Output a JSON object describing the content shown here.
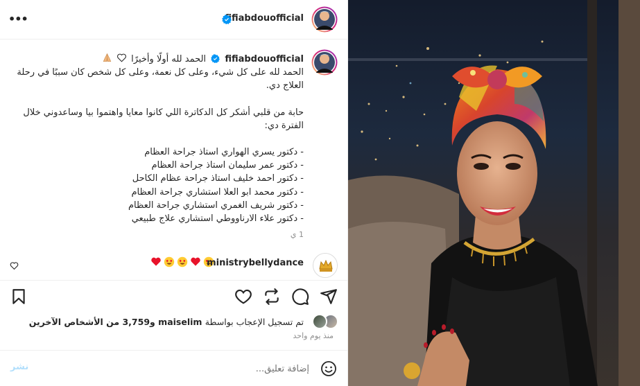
{
  "post": {
    "author": "fifiabdouofficial",
    "caption": {
      "headline": "الحمد لله أولًا وأخيرًا",
      "paragraph1": "الحمد لله على كل شيء، وعلى كل نعمة، وعلى كل شخص كان سببًا في رحلة العلاج دي.",
      "paragraph2": "حابة من قلبي أشكر كل الدكاترة اللي كانوا معايا واهتموا بيا وساعدوني خلال الفترة دي:",
      "doctors": [
        "- دكتور يسري الهواري استاذ جراحة العظام",
        "- دكتور عمر سليمان استاذ جراحة العظام",
        "- دكتور احمد خليف استاذ جراحة عظام الكاحل",
        "- دكتور محمد ابو العلا استشاري جراحة العظام",
        "- دكتور شريف الغمري استشاري جراحة العظام",
        "- دكتور علاء الارناووطي استشاري علاج طبيعي"
      ],
      "time": "1 ي"
    },
    "comment": {
      "author": "ministrybellydance",
      "emojis": [
        "heart-eyes-emoji",
        "heart-emoji",
        "heart-eyes-emoji",
        "heart-eyes-emoji",
        "heart-emoji"
      ]
    },
    "likes": {
      "prefix": "تم تسجيل الإعجاب بواسطة",
      "liker": "maiselim",
      "others": "و3,759 من الأشخاص الآخرين"
    },
    "time_ago": "منذ يوم واحد",
    "comment_placeholder": "إضافة تعليق...",
    "post_label": "نشر"
  },
  "colors": {
    "verified": "#0095f6",
    "heart": "#ed4956",
    "post_disabled": "#b2dffc",
    "muted": "#8e8e8e"
  }
}
